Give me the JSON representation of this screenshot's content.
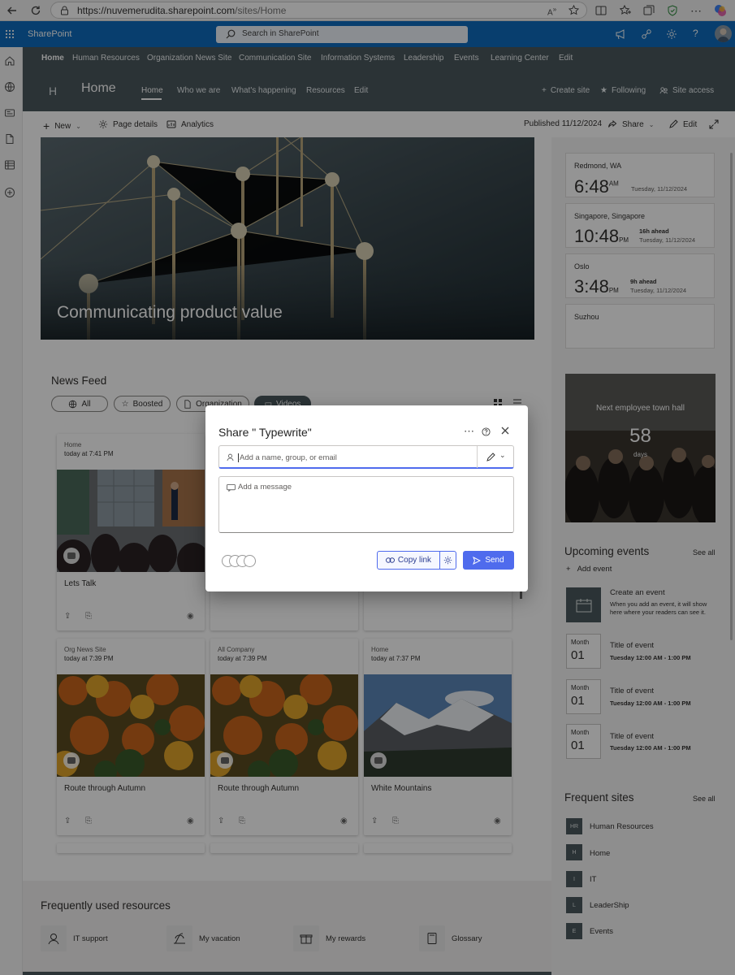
{
  "browser": {
    "url": "https://nuvemerudita.sharepoint.com/sites/Home",
    "url_host": "https://nuvemerudita.sharepoint.com",
    "url_path": "/sites/Home"
  },
  "suite_bar": {
    "app_name": "SharePoint",
    "search_placeholder": "Search in SharePoint",
    "brand_color": "#0f6cbd"
  },
  "hub_nav": {
    "items": [
      "Home",
      "Human Resources",
      "Organization News Site",
      "Communication Site",
      "Information Systems",
      "Leadership",
      "Events",
      "Learning Center",
      "Edit"
    ]
  },
  "site_header": {
    "logo_letter": "H",
    "title": "Home",
    "nav": [
      "Home",
      "Who we are",
      "What's happening",
      "Resources",
      "Edit"
    ],
    "actions": [
      "Create site",
      "Following",
      "Site access"
    ],
    "header_color": "#4b585e"
  },
  "command_bar": {
    "new": "New",
    "page_details": "Page details",
    "analytics": "Analytics",
    "published": "Published 11/12/2024",
    "share": "Share",
    "edit": "Edit"
  },
  "hero": {
    "title": "Communicating product value"
  },
  "news_feed": {
    "title": "News Feed",
    "filters": [
      "All",
      "Boosted",
      "Organization",
      "Videos"
    ],
    "cards": [
      {
        "source": "Home",
        "time": "today at 7:41 PM",
        "title": "Lets Talk"
      },
      {
        "source": "Org News Site",
        "time": "today at 7:39 PM",
        "title": "Route through Autumn"
      },
      {
        "source": "All Company",
        "time": "today at 7:39 PM",
        "title": "Route through Autumn"
      },
      {
        "source": "Home",
        "time": "today at 7:37 PM",
        "title": "White Mountains"
      }
    ]
  },
  "world_clock": [
    {
      "city": "Redmond, WA",
      "time": "6:48",
      "ampm": "AM",
      "note": "",
      "date": "Tuesday, 11/12/2024"
    },
    {
      "city": "Singapore, Singapore",
      "time": "10:48",
      "ampm": "PM",
      "note": "16h ahead",
      "date": "Tuesday, 11/12/2024"
    },
    {
      "city": "Oslo",
      "time": "3:48",
      "ampm": "PM",
      "note": "9h ahead",
      "date": "Tuesday, 11/12/2024"
    },
    {
      "city": "Suzhou",
      "time": "",
      "ampm": "",
      "note": "",
      "date": ""
    }
  ],
  "countdown": {
    "title": "Next employee town hall",
    "number": "58",
    "unit": "days"
  },
  "events": {
    "title": "Upcoming events",
    "see_all": "See all",
    "add_event": "Add event",
    "create_title": "Create an event",
    "create_desc": "When you add an event, it will show here where your readers can see it.",
    "items": [
      {
        "month": "Month",
        "day": "01",
        "title": "Title of event",
        "time": "Tuesday 12:00 AM - 1:00 PM"
      },
      {
        "month": "Month",
        "day": "01",
        "title": "Title of event",
        "time": "Tuesday 12:00 AM - 1:00 PM"
      },
      {
        "month": "Month",
        "day": "01",
        "title": "Title of event",
        "time": "Tuesday 12:00 AM - 1:00 PM"
      }
    ]
  },
  "frequent_sites": {
    "title": "Frequent sites",
    "see_all": "See all",
    "items": [
      {
        "abbr": "HR",
        "name": "Human Resources"
      },
      {
        "abbr": "H",
        "name": "Home"
      },
      {
        "abbr": "I",
        "name": "IT"
      },
      {
        "abbr": "L",
        "name": "LeaderShip"
      },
      {
        "abbr": "E",
        "name": "Events"
      }
    ]
  },
  "resources": {
    "title": "Frequently used resources",
    "items": [
      "IT support",
      "My vacation",
      "My rewards",
      "Glossary"
    ]
  },
  "share_dialog": {
    "title": "Share \" Typewrite\"",
    "people_placeholder": "Add a name, group, or email",
    "message_placeholder": "Add a message",
    "copy_link": "Copy link",
    "send": "Send",
    "accent": "#4f6bed"
  }
}
